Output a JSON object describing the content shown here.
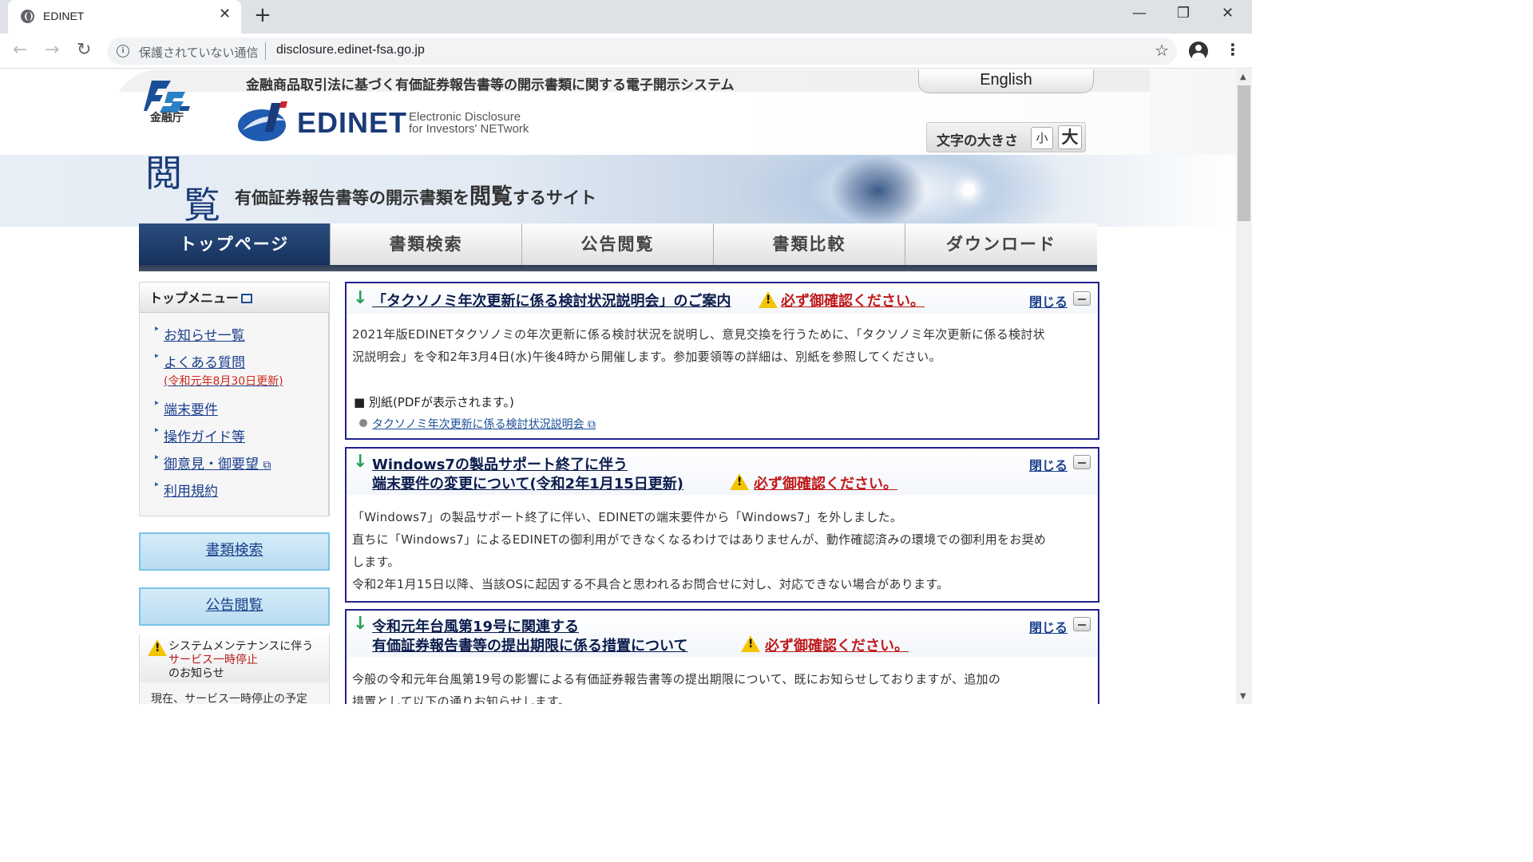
{
  "browser": {
    "tab_title": "EDINET",
    "new_tab": "+",
    "tab_close": "✕",
    "insecure_label": "保護されていない通信",
    "url": "disclosure.edinet-fsa.go.jp",
    "window_min": "—",
    "window_restore": "❐",
    "window_close": "✕",
    "back": "←",
    "forward": "→",
    "reload": "↻",
    "bookmark": "☆",
    "menu": "⋮"
  },
  "header": {
    "fsa_label": "金融庁",
    "system_title": "金融商品取引法に基づく有価証券報告書等の開示書類に関する電子開示システム",
    "brand_name": "EDINET",
    "brand_sub_1": "Electronic Disclosure",
    "brand_sub_2": "for Investors' NETwork",
    "english_link": "English",
    "fontsize_label": "文字の大きさ",
    "fontsize_small": "小",
    "fontsize_large": "大"
  },
  "banner": {
    "kanji_1": "閲",
    "kanji_2": "覧",
    "tagline_pre": "有価証券報告書等の開示書類を",
    "tagline_em": "閲覧",
    "tagline_post": "するサイト"
  },
  "nav": {
    "tabs": [
      "トップページ",
      "書類検索",
      "公告閲覧",
      "書類比較",
      "ダウンロード"
    ]
  },
  "sidebar": {
    "menu_title": "トップメニュー",
    "items": [
      {
        "label": "お知らせ一覧"
      },
      {
        "label": "よくある質問",
        "note": "(令和元年8月30日更新)"
      },
      {
        "label": "端末要件"
      },
      {
        "label": "操作ガイド等"
      },
      {
        "label": "御意見・御要望"
      },
      {
        "label": "利用規約"
      }
    ],
    "btn_search": "書類検索",
    "btn_notice": "公告閲覧",
    "maint_line1": "システムメンテナンスに伴う",
    "maint_line2": "サービス一時停止",
    "maint_line3": "のお知らせ",
    "maint_line4": "現在、サービス一時停止の予定"
  },
  "notices": [
    {
      "title": "「タクソノミ年次更新に係る検討状況説明会」のご案内",
      "must": "必ず御確認ください。",
      "close": "閉じる",
      "body_1": "2021年版EDINETタクソノミの年次更新に係る検討状況を説明し、意見交換を行うために、「タクソノミ年次更新に係る検討状",
      "body_2": "況説明会」を令和2年3月4日(水)午後4時から開催します。参加要領等の詳細は、別紙を参照してください。",
      "attach_label": "■ 別紙(PDFが表示されます。)",
      "attach_link": "タクソノミ年次更新に係る検討状況説明会"
    },
    {
      "title_1": "Windows7の製品サポート終了に伴う",
      "title_2": "端末要件の変更について(令和2年1月15日更新)",
      "must": "必ず御確認ください。",
      "close": "閉じる",
      "body_1": "「Windows7」の製品サポート終了に伴い、EDINETの端末要件から「Windows7」を外しました。",
      "body_2": "直ちに「Windows7」によるEDINETの御利用ができなくなるわけではありませんが、動作確認済みの環境での御利用をお奨め",
      "body_3": "します。",
      "body_4": "令和2年1月15日以降、当該OSに起因する不具合と思われるお問合せに対し、対応できない場合があります。"
    },
    {
      "title_1": "令和元年台風第19号に関連する",
      "title_2": "有価証券報告書等の提出期限に係る措置について",
      "must": "必ず御確認ください。",
      "close": "閉じる",
      "body_1": "今般の令和元年台風第19号の影響による有価証券報告書等の提出期限について、既にお知らせしておりますが、追加の",
      "body_2": "措置として以下の通りお知らせします。"
    }
  ],
  "colors": {
    "nav_active": "#1e3f6e",
    "brand_blue": "#1a3a7a",
    "alert_red": "#c01b1b",
    "notice_border": "#21218f"
  }
}
